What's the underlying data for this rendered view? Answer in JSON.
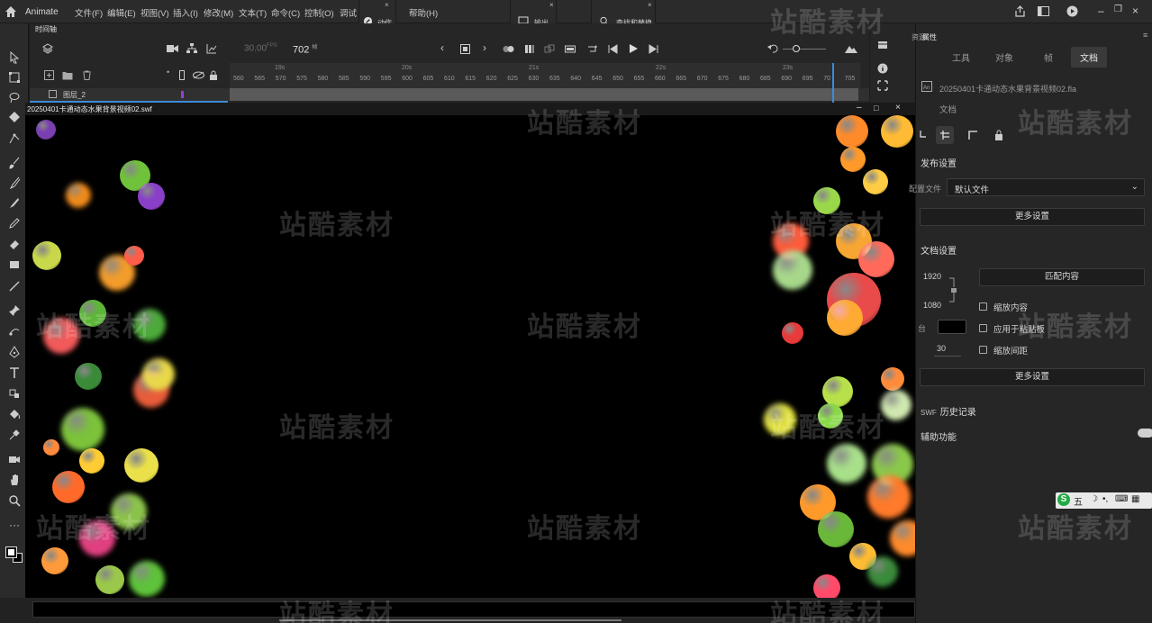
{
  "app": {
    "name": "Animate"
  },
  "menu": [
    "文件(F)",
    "编辑(E)",
    "视图(V)",
    "插入(I)",
    "修改(M)",
    "文本(T)",
    "命令(C)",
    "控制(O)",
    "调试",
    "帮助(H)"
  ],
  "float_panels": {
    "action": "动作",
    "output": "输出",
    "find_replace": "查找和替换"
  },
  "timeline": {
    "title": "时间轴",
    "fps": "30.00",
    "fps_unit": "FPS",
    "current_frame": "702",
    "frame_unit": "帧",
    "layer_name": "图层_2",
    "ruler_ticks": [
      "560",
      "565",
      "570",
      "575",
      "580",
      "585",
      "590",
      "595",
      "600",
      "605",
      "610",
      "615",
      "620",
      "625",
      "630",
      "635",
      "640",
      "645",
      "650",
      "655",
      "660",
      "665",
      "670",
      "675",
      "680",
      "685",
      "690",
      "695",
      "70",
      "705"
    ],
    "seconds": [
      "19s",
      "20s",
      "21s",
      "22s",
      "23s"
    ]
  },
  "stage": {
    "title": "20250401卡通动态水果背景视频02.swf"
  },
  "properties": {
    "top_tabs": [
      "资源",
      "属性"
    ],
    "tabs": [
      "工具",
      "对象",
      "帧",
      "文档"
    ],
    "active_tab": "文档",
    "filename": "20250401卡通动态水果背景视频02.fla",
    "doc_label": "文档",
    "publish": {
      "title": "发布设置",
      "profile_label": "配置文件",
      "profile_value": "默认文件",
      "more": "更多设置"
    },
    "document": {
      "title": "文档设置",
      "width": "1920",
      "height": "1080",
      "match_content": "匹配内容",
      "scale_content": "缩放内容",
      "apply_pasteboard": "应用于粘贴板",
      "fps": "30",
      "scale_spacing": "缩放间距",
      "more": "更多设置",
      "bg_color": "#000000"
    },
    "swf_history": "历史记录",
    "swf_prefix": "SWF",
    "accessibility": "辅助功能"
  },
  "ime": {
    "label": "五"
  },
  "watermark": "站酷素材",
  "colors": {
    "accent": "#3d8bd8",
    "panel": "#262626",
    "stage": "#000000"
  }
}
